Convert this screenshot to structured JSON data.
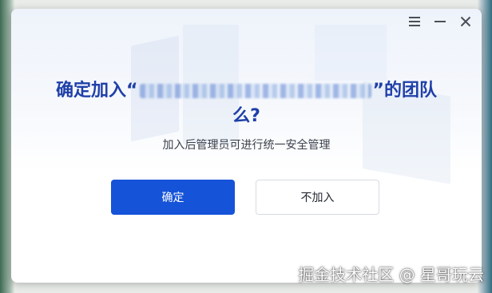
{
  "window": {
    "controls": [
      "menu-icon",
      "minimize-icon",
      "close-icon"
    ]
  },
  "dialog": {
    "title_prefix": "确定加入“",
    "title_suffix": "”的团队么?",
    "subtitle": "加入后管理员可进行统一安全管理",
    "confirm_label": "确定",
    "cancel_label": "不加入"
  },
  "watermark": "掘金技术社区 @ 星哥玩云",
  "colors": {
    "title": "#1f3fa8",
    "primary": "#1553d8"
  }
}
